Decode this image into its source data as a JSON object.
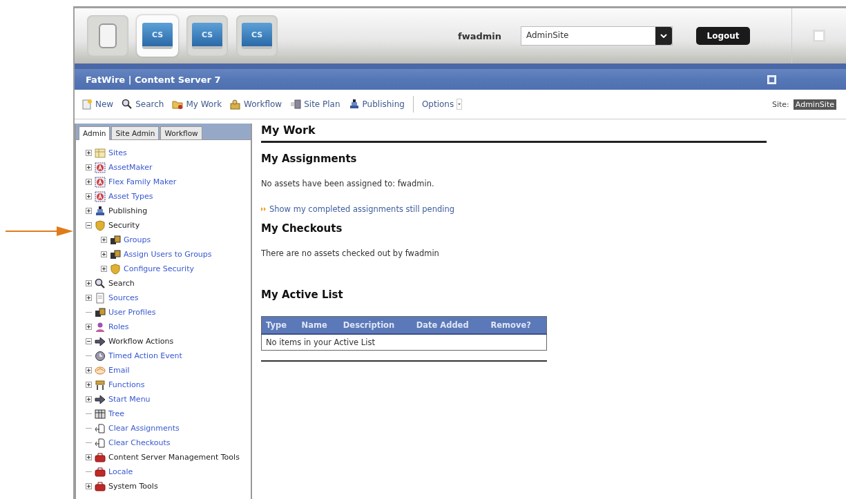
{
  "app_launcher": [
    {
      "kind": "device",
      "selected": false
    },
    {
      "label": "CS",
      "kind": "monitor",
      "selected": true
    },
    {
      "label": "CS",
      "kind": "monitor",
      "selected": false
    },
    {
      "label": "CS",
      "kind": "monitor",
      "selected": false
    }
  ],
  "user": "fwadmin",
  "site_select": {
    "value": "AdminSite"
  },
  "logout_button": "Logout",
  "title_bar": {
    "title": "FatWire | Content Server 7"
  },
  "toolbar": {
    "items": [
      {
        "label": "New",
        "kind": "new"
      },
      {
        "label": "Search",
        "kind": "search"
      },
      {
        "label": "My Work",
        "kind": "folder"
      },
      {
        "label": "Workflow",
        "kind": "workflow"
      },
      {
        "label": "Site Plan",
        "kind": "siteplan"
      },
      {
        "label": "Publishing",
        "kind": "publish"
      }
    ],
    "options": "Options",
    "site_label": "Site:",
    "site_value": "AdminSite"
  },
  "sidebar": {
    "tabs": [
      {
        "label": "Admin",
        "selected": true
      },
      {
        "label": "Site Admin",
        "selected": false
      },
      {
        "label": "Workflow",
        "selected": false
      }
    ],
    "tree": [
      {
        "label": "Sites",
        "kind": "sites",
        "link": true,
        "expanded": false
      },
      {
        "label": "AssetMaker",
        "kind": "asset",
        "link": true,
        "expanded": false
      },
      {
        "label": "Flex Family Maker",
        "kind": "asset",
        "link": true,
        "expanded": false
      },
      {
        "label": "Asset Types",
        "kind": "asset",
        "link": true,
        "expanded": false
      },
      {
        "label": "Publishing",
        "kind": "publish",
        "link": false,
        "expanded": false
      },
      {
        "label": "Security",
        "kind": "shield",
        "link": false,
        "expanded": true,
        "children": [
          {
            "label": "Groups",
            "kind": "people",
            "link": true,
            "expanded": false
          },
          {
            "label": "Assign Users to Groups",
            "kind": "people",
            "link": true,
            "expanded": false
          },
          {
            "label": "Configure Security",
            "kind": "shield",
            "link": true,
            "expanded": false
          }
        ]
      },
      {
        "label": "Search",
        "kind": "search",
        "link": false,
        "expanded": false
      },
      {
        "label": "Sources",
        "kind": "doc",
        "link": true,
        "expanded": false
      },
      {
        "label": "User Profiles",
        "kind": "people",
        "link": true
      },
      {
        "label": "Roles",
        "kind": "person",
        "link": true,
        "expanded": false
      },
      {
        "label": "Workflow Actions",
        "kind": "arrow",
        "link": false,
        "expanded": true
      },
      {
        "label": "Timed Action Event",
        "kind": "clock",
        "link": true
      },
      {
        "label": "Email",
        "kind": "email",
        "link": true,
        "expanded": false
      },
      {
        "label": "Functions",
        "kind": "functions",
        "link": true,
        "expanded": false
      },
      {
        "label": "Start Menu",
        "kind": "arrow",
        "link": true,
        "expanded": false
      },
      {
        "label": "Tree",
        "kind": "table",
        "link": true
      },
      {
        "label": "Clear Assignments",
        "kind": "clear",
        "link": true
      },
      {
        "label": "Clear Checkouts",
        "kind": "clear",
        "link": true
      },
      {
        "label": "Content Server Management Tools",
        "kind": "toolbox",
        "link": false,
        "expanded": false
      },
      {
        "label": "Locale",
        "kind": "toolbox",
        "link": true
      },
      {
        "label": "System Tools",
        "kind": "toolbox",
        "link": false,
        "expanded": false
      }
    ]
  },
  "main": {
    "title": "My Work",
    "assignments": {
      "heading": "My Assignments",
      "message": "No assets have been assigned to: fwadmin.",
      "link": "Show my completed assignments still pending"
    },
    "checkouts": {
      "heading": "My Checkouts",
      "message": "There are no assets checked out by fwadmin"
    },
    "active_list": {
      "heading": "My Active List",
      "columns": [
        "Type",
        "Name",
        "Description",
        "Date Added",
        "Remove?"
      ],
      "empty_message": "No items in your Active List"
    }
  }
}
